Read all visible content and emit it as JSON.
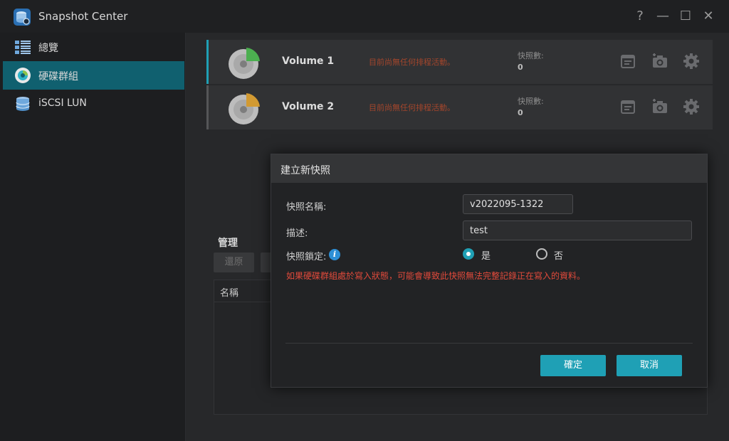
{
  "app": {
    "title": "Snapshot Center",
    "window_controls": [
      "?",
      "—",
      "☐",
      "✕"
    ]
  },
  "sidebar": {
    "items": [
      {
        "label": "總覽",
        "icon": "overview-grid-icon"
      },
      {
        "label": "硬碟群組",
        "icon": "storage-pool-icon",
        "active": true
      },
      {
        "label": "iSCSI LUN",
        "icon": "iscsi-database-icon"
      }
    ]
  },
  "volumes": [
    {
      "name": "Volume 1",
      "status": "目前尚無任何排程活動。",
      "count_label": "快照數:",
      "count": "0",
      "accent": "#1fa0b5",
      "pie_color": "#4caf50"
    },
    {
      "name": "Volume 2",
      "status": "目前尚無任何排程活動。",
      "count_label": "快照數:",
      "count": "0",
      "accent": "#555658",
      "pie_color": "#d29a32"
    }
  ],
  "management": {
    "title": "管理",
    "buttons": [
      "還原",
      ""
    ],
    "table_header": "名稱"
  },
  "dialog": {
    "title": "建立新快照",
    "name_label": "快照名稱:",
    "name_value": "v2022095-1322",
    "desc_label": "描述:",
    "desc_value": "test",
    "lock_label": "快照鎖定:",
    "lock_yes": "是",
    "lock_no": "否",
    "lock_selected": "是",
    "warning": "如果硬碟群組處於寫入狀態，可能會導致此快照無法完整記錄正在寫入的資料。",
    "ok": "確定",
    "cancel": "取消"
  },
  "colors": {
    "accent": "#1fa0b5",
    "warning": "#e24a3b",
    "status": "#a4462c"
  }
}
